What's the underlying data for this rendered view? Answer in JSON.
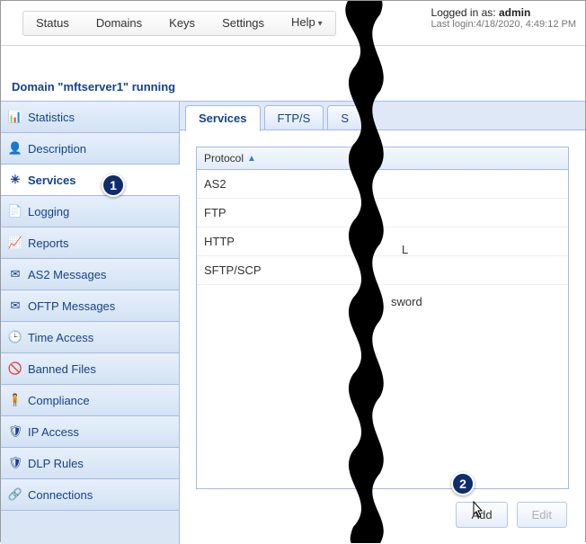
{
  "top_nav": {
    "items": [
      "Status",
      "Domains",
      "Keys",
      "Settings",
      "Help"
    ]
  },
  "login": {
    "prefix": "Logged in as: ",
    "user": "admin",
    "lastlogin_label": "Last login:",
    "lastlogin_value": "4/18/2020, 4:49:12 PM"
  },
  "domain_bar": "Domain \"mftserver1\" running",
  "sidebar": {
    "items": [
      {
        "label": "Statistics",
        "icon": "chart-bar-icon"
      },
      {
        "label": "Description",
        "icon": "user-icon"
      },
      {
        "label": "Services",
        "icon": "gear-icon",
        "selected": true
      },
      {
        "label": "Logging",
        "icon": "document-icon"
      },
      {
        "label": "Reports",
        "icon": "bar-icon"
      },
      {
        "label": "AS2 Messages",
        "icon": "envelope-icon"
      },
      {
        "label": "OFTP Messages",
        "icon": "envelope-icon"
      },
      {
        "label": "Time Access",
        "icon": "clock-icon"
      },
      {
        "label": "Banned Files",
        "icon": "ban-icon"
      },
      {
        "label": "Compliance",
        "icon": "person-icon"
      },
      {
        "label": "IP Access",
        "icon": "shield-icon"
      },
      {
        "label": "DLP Rules",
        "icon": "shield2-icon"
      },
      {
        "label": "Connections",
        "icon": "link-icon"
      }
    ]
  },
  "tabs": [
    "Services",
    "FTP/S",
    "S"
  ],
  "grid": {
    "header": "Protocol",
    "rows": [
      "AS2",
      "FTP",
      "HTTP",
      "SFTP/SCP"
    ],
    "right_fragments": [
      "",
      "L",
      "",
      "sword"
    ]
  },
  "buttons": {
    "add": "Add",
    "edit": "Edit"
  },
  "annotations": {
    "badge1": "1",
    "badge2": "2"
  }
}
